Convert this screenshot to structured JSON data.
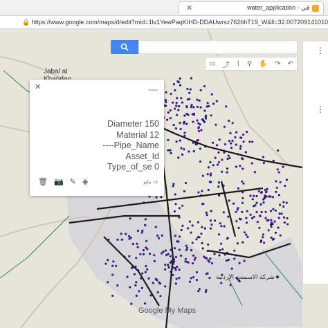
{
  "browser": {
    "tab_title": "water_application - ڤي",
    "url": "https://www.google.com/maps/d/edit?mid=1lv1YewPaqKIHD-DDAUwrsz762bhT19_W&ll=32.00720914101099%2C35.769939"
  },
  "map": {
    "place_label_1": "Jabal al",
    "place_label_2": "Khandaq",
    "poi_label": "شركة الاسمنت الاردنية",
    "footer_brand": "Google My Maps"
  },
  "popup": {
    "header": "----",
    "fields": [
      "Diameter 150",
      "Material 12",
      "----Pipe_Name",
      "Asset_Id",
      "Type_of_se 0"
    ],
    "timestamp": "١٨ مايو"
  },
  "colors": {
    "accent": "#4285f4",
    "pipe": "#1a1a1a",
    "marker": "#4a148c",
    "water_line": "#2e8b57"
  }
}
